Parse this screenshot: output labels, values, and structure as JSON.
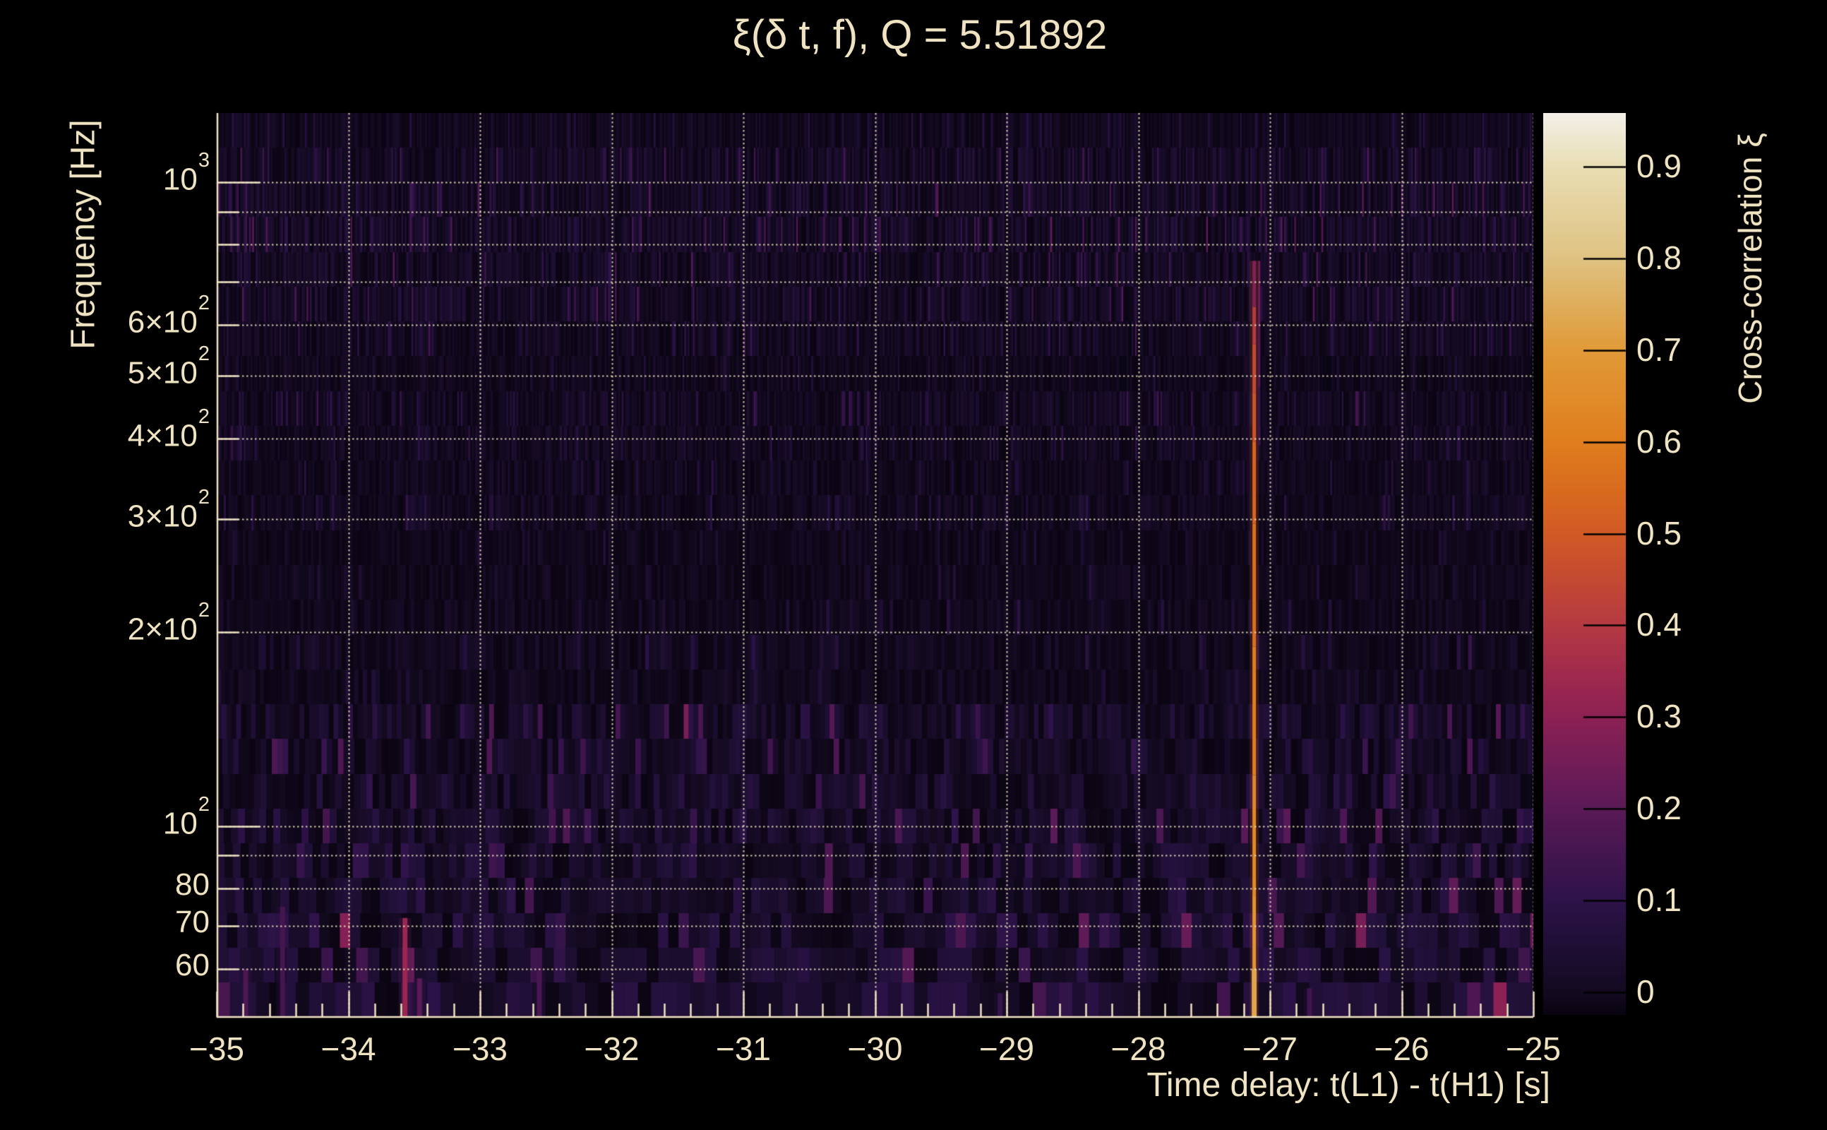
{
  "figure": {
    "title": "ξ(δ t, f), Q = 5.51892",
    "background_color": "#000000",
    "text_color": "#efe3c2",
    "grid_color": "rgba(240,229,197,0.85)"
  },
  "axes": {
    "x": {
      "title": "Time delay: t(L1) - t(H1) [s]",
      "min": -35,
      "max": -25,
      "major_ticks": [
        -35,
        -34,
        -33,
        -32,
        -31,
        -30,
        -29,
        -28,
        -27,
        -26,
        -25
      ],
      "tick_labels": [
        "−35",
        "−34",
        "−33",
        "−32",
        "−31",
        "−30",
        "−29",
        "−28",
        "−27",
        "−26",
        "−25"
      ],
      "minor_tick_step": 0.2,
      "gridlines": [
        -34,
        -33,
        -32,
        -31,
        -30,
        -29,
        -28,
        -27,
        -26,
        -25
      ]
    },
    "y": {
      "title": "Frequency [Hz]",
      "scale": "log",
      "min_hz": 50.4,
      "max_hz": 1281,
      "tick_labels": [
        {
          "hz": 1000,
          "base": "10",
          "exp": "3"
        },
        {
          "hz": 600,
          "base": "6×10",
          "exp": "2"
        },
        {
          "hz": 500,
          "base": "5×10",
          "exp": "2"
        },
        {
          "hz": 400,
          "base": "4×10",
          "exp": "2"
        },
        {
          "hz": 300,
          "base": "3×10",
          "exp": "2"
        },
        {
          "hz": 200,
          "base": "2×10",
          "exp": "2"
        },
        {
          "hz": 100,
          "base": "10",
          "exp": "2"
        },
        {
          "hz": 80,
          "base": "80"
        },
        {
          "hz": 70,
          "base": "70"
        },
        {
          "hz": 60,
          "base": "60"
        }
      ],
      "gridlines": [
        1000,
        900,
        800,
        700,
        600,
        500,
        400,
        300,
        200,
        100,
        90,
        80,
        70,
        60
      ],
      "long_tick_hz": [
        1000,
        100
      ]
    },
    "colorbar": {
      "title": "Cross-correlation ξ",
      "min": -0.0246,
      "max": 0.9585,
      "tick_values": [
        0,
        0.1,
        0.2,
        0.3,
        0.4,
        0.5,
        0.6,
        0.7,
        0.8,
        0.9
      ],
      "tick_labels": [
        "0",
        "0.1",
        "0.2",
        "0.3",
        "0.4",
        "0.5",
        "0.6",
        "0.7",
        "0.8",
        "0.9"
      ]
    }
  },
  "chart_data": {
    "type": "heatmap",
    "title": "ξ(δ t, f), Q = 5.51892",
    "q_value": 5.51892,
    "xlabel": "Time delay: t(L1) - t(H1) [s]",
    "ylabel": "Frequency [Hz]",
    "zlabel": "Cross-correlation ξ",
    "x_range_s": [
      -35,
      -25
    ],
    "y_range_hz": [
      50.4,
      1281
    ],
    "y_scale": "log",
    "z_range": [
      -0.0246,
      0.9585
    ],
    "grid": "dotted, every 1 s in x, log decades and subdecades in y",
    "legend_position": "right colorbar",
    "noise_floor_xi": [
      0,
      0.12
    ],
    "main_ridge": {
      "time_delay_s": -27.12,
      "peak_xi": 0.73,
      "segments": [
        {
          "f_hi": 755,
          "f_lo": 640,
          "xi": 0.28
        },
        {
          "f_hi": 640,
          "f_lo": 560,
          "xi": 0.4
        },
        {
          "f_hi": 560,
          "f_lo": 470,
          "xi": 0.45
        },
        {
          "f_hi": 470,
          "f_lo": 395,
          "xi": 0.48
        },
        {
          "f_hi": 395,
          "f_lo": 295,
          "xi": 0.53
        },
        {
          "f_hi": 295,
          "f_lo": 190,
          "xi": 0.56
        },
        {
          "f_hi": 190,
          "f_lo": 120,
          "xi": 0.6
        },
        {
          "f_hi": 120,
          "f_lo": 78,
          "xi": 0.64
        },
        {
          "f_hi": 78,
          "f_lo": 58,
          "xi": 0.68
        },
        {
          "f_hi": 58,
          "f_lo": 50.4,
          "xi": 0.73
        }
      ],
      "companion": {
        "time_delay_s": -27.082,
        "segments": [
          {
            "f_hi": 755,
            "f_lo": 600,
            "xi": 0.24
          },
          {
            "f_hi": 600,
            "f_lo": 480,
            "xi": 0.19
          },
          {
            "f_hi": 480,
            "f_lo": 390,
            "xi": 0.13
          }
        ]
      }
    },
    "hot_columns": [
      {
        "time_delay_s": -33.57,
        "f_top_hz": 72,
        "xi": 0.33
      },
      {
        "time_delay_s": -33.46,
        "f_top_hz": 58,
        "xi": 0.2
      },
      {
        "time_delay_s": -34.5,
        "f_top_hz": 75,
        "xi": 0.15
      },
      {
        "time_delay_s": -34.78,
        "f_top_hz": 60,
        "xi": 0.17
      },
      {
        "time_delay_s": -32.55,
        "f_top_hz": 60,
        "xi": 0.16
      },
      {
        "time_delay_s": -26.7,
        "f_top_hz": 56,
        "xi": 0.14
      },
      {
        "time_delay_s": -29.05,
        "f_top_hz": 55,
        "xi": 0.12
      }
    ],
    "colormap_stops": [
      [
        -0.0246,
        "#090410"
      ],
      [
        0.0,
        "#130a20"
      ],
      [
        0.05,
        "#1f0f35"
      ],
      [
        0.1,
        "#2d1349"
      ],
      [
        0.15,
        "#44164f"
      ],
      [
        0.2,
        "#5a1a57"
      ],
      [
        0.25,
        "#731e57"
      ],
      [
        0.3,
        "#8c2154"
      ],
      [
        0.35,
        "#a12b4d"
      ],
      [
        0.4,
        "#b53a42"
      ],
      [
        0.45,
        "#c44a32"
      ],
      [
        0.5,
        "#d25a26"
      ],
      [
        0.55,
        "#d96c1e"
      ],
      [
        0.6,
        "#e07e1e"
      ],
      [
        0.65,
        "#e18c2a"
      ],
      [
        0.7,
        "#e29a38"
      ],
      [
        0.75,
        "#dfae5c"
      ],
      [
        0.8,
        "#dfc382"
      ],
      [
        0.85,
        "#e4d09b"
      ],
      [
        0.9,
        "#e9deb4"
      ],
      [
        0.9585,
        "#f3f0e9"
      ]
    ]
  }
}
